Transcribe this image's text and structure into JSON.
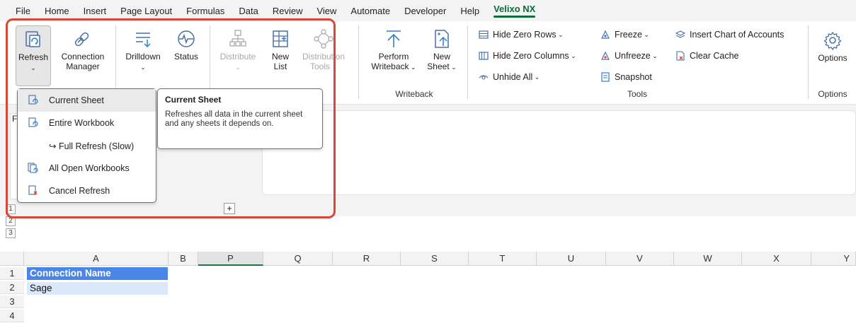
{
  "menu": {
    "items": [
      "File",
      "Home",
      "Insert",
      "Page Layout",
      "Formulas",
      "Data",
      "Review",
      "View",
      "Automate",
      "Developer",
      "Help",
      "Velixo NX"
    ],
    "active": "Velixo NX"
  },
  "ribbon": {
    "refresh": "Refresh",
    "connection_manager_1": "Connection",
    "connection_manager_2": "Manager",
    "drilldown": "Drilldown",
    "status": "Status",
    "distribute": "Distribute",
    "new_list_1": "New",
    "new_list_2": "List",
    "distribution_tools_1": "Distribution",
    "distribution_tools_2": "Tools",
    "perform_writeback_1": "Perform",
    "perform_writeback_2": "Writeback",
    "new_sheet_1": "New",
    "new_sheet_2": "Sheet",
    "writeback_group": "Writeback",
    "hide_zero_rows": "Hide Zero Rows",
    "hide_zero_columns": "Hide Zero Columns",
    "unhide_all": "Unhide All",
    "freeze": "Freeze",
    "unfreeze": "Unfreeze",
    "snapshot": "Snapshot",
    "insert_chart": "Insert Chart of Accounts",
    "clear_cache": "Clear Cache",
    "tools_group": "Tools",
    "options": "Options",
    "options_group": "Options"
  },
  "dropdown": {
    "items": [
      "Current Sheet",
      "Entire Workbook",
      "↪ Full Refresh (Slow)",
      "All Open Workbooks",
      "Cancel Refresh"
    ]
  },
  "tooltip": {
    "title": "Current Sheet",
    "body": "Refreshes all data in the current sheet and any sheets it depends on."
  },
  "sheet_stub": "F",
  "outline_levels": [
    "1",
    "2",
    "3"
  ],
  "plus": "+",
  "grid": {
    "columns": [
      "A",
      "B",
      "P",
      "Q",
      "R",
      "S",
      "T",
      "U",
      "V",
      "W",
      "X",
      "Y"
    ],
    "rows": [
      "1",
      "2",
      "3",
      "4"
    ],
    "a1": "Connection Name",
    "a2": "Sage"
  },
  "colors": {
    "accent": "#0e6b3a",
    "highlight": "#d9473a",
    "header_fill": "#4a86e8",
    "value_fill": "#dbe8fb"
  }
}
